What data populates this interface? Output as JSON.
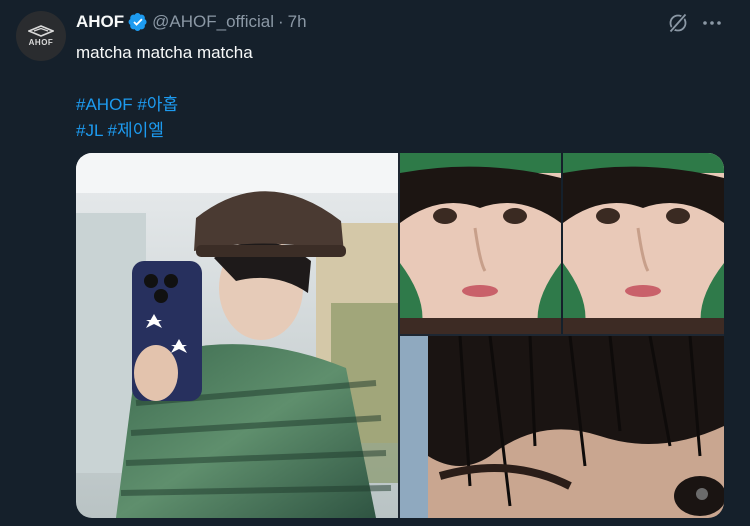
{
  "tweet": {
    "avatar": {
      "logo_text": "AHOF"
    },
    "author": {
      "name": "AHOF",
      "handle": "@AHOF_official",
      "separator": "·",
      "time": "7h"
    },
    "text": "matcha matcha matcha",
    "hashtags": [
      [
        "#AHOF",
        "#아홉"
      ],
      [
        "#JL",
        "#제이엘"
      ]
    ],
    "icons": {
      "verified": "verified-badge-icon",
      "grok": "grok-icon",
      "more": "more-horizontal-icon"
    },
    "media": [
      {
        "alt": "mirror-selfie-photo"
      },
      {
        "alt": "closeup-face-collage-photo"
      },
      {
        "alt": "hair-eye-closeup-photo"
      }
    ]
  },
  "colors": {
    "background": "#15202b",
    "text": "#f7f9f9",
    "secondary": "#8b98a5",
    "accent": "#1d9bf0"
  }
}
